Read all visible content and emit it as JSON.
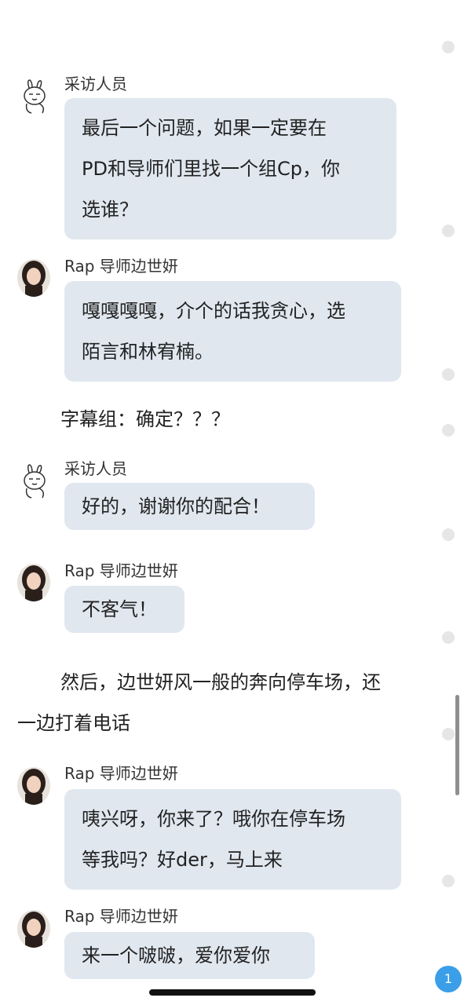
{
  "messages": [
    {
      "name": "采访人员",
      "lines": [
        "最后一个问题，如果一定要在",
        "PD和导师们里找一个组Cp，你",
        "选谁？"
      ]
    },
    {
      "name": "Rap 导师边世妍",
      "lines": [
        "嘎嘎嘎嘎，介个的话我贪心，选",
        "陌言和林宥楠。"
      ]
    },
    {
      "narration": "字幕组：确定？？？"
    },
    {
      "name": "采访人员",
      "lines": [
        "好的，谢谢你的配合！"
      ]
    },
    {
      "name": "Rap 导师边世妍",
      "lines": [
        "不客气！"
      ]
    },
    {
      "narration_lines": [
        "然后，边世妍风一般的奔向停车场，还",
        "一边打着电话"
      ]
    },
    {
      "name": "Rap 导师边世妍",
      "lines": [
        "咦兴呀，你来了？哦你在停车场",
        "等我吗？好der，马上来"
      ]
    },
    {
      "name": "Rap 导师边世妍",
      "lines": [
        "来一个啵啵，爱你爱你"
      ]
    }
  ],
  "badge_count": "1",
  "colors": {
    "bubble": "#e0e7ef",
    "badge": "#3b9ee8"
  }
}
